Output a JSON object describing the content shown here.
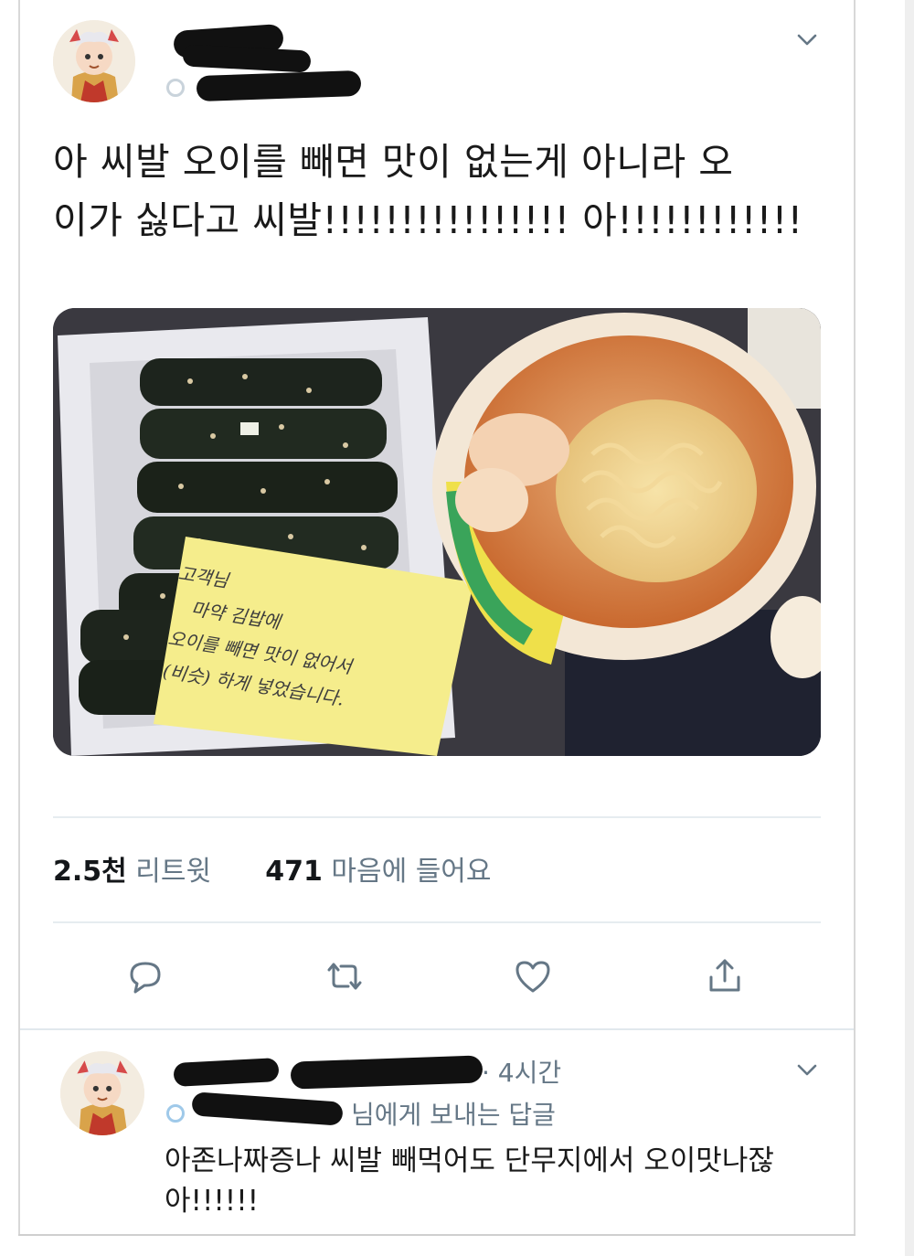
{
  "tweet": {
    "text": "아 씨발 오이를 빼면 맛이 없는게 아니라 오\n이가 싫다고 씨발!!!!!!!!!!!!!!!! 아!!!!!!!!!!!!",
    "note_lines": [
      "고객님",
      "마약 김밥에",
      "오이를 빼면 맛이 없어서",
      "(비슷) 하게 넣었습니다."
    ],
    "retweets_count": "2.5천",
    "retweets_label": "리트윗",
    "likes_count": "471",
    "likes_label": "마음에 들어요"
  },
  "reply": {
    "time": "· 4시간",
    "reply_to": "님에게 보내는 답글",
    "text": "아존나짜증나 씨발 빼먹어도 단무지에서 오이맛나잖\n아!!!!!!"
  },
  "colors": {
    "accent": "#1da1f2",
    "muted": "#657786",
    "icon": "#657786"
  }
}
